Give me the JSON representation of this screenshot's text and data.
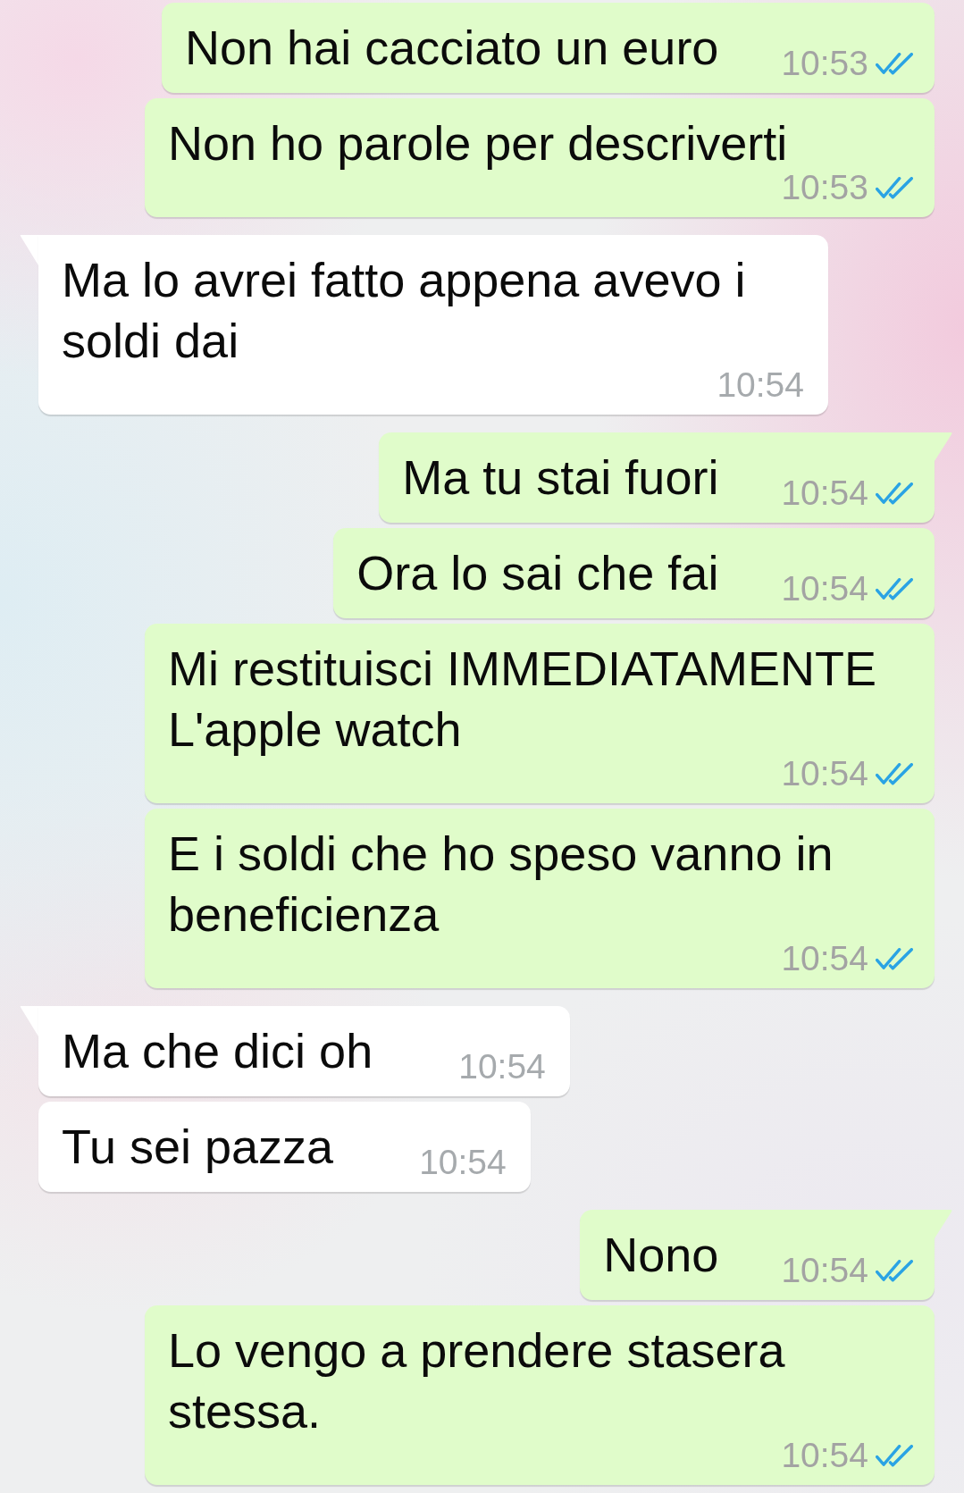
{
  "messages": [
    {
      "kind": "sent",
      "text": "Non hai cacciato un euro",
      "time": "10:53",
      "read": true,
      "tail": false
    },
    {
      "kind": "sent",
      "text": "Non ho parole per descriverti",
      "time": "10:53",
      "read": true,
      "tail": false
    },
    {
      "kind": "received",
      "text": "Ma lo avrei fatto appena avevo i soldi dai",
      "time": "10:54",
      "tail": true
    },
    {
      "kind": "sent",
      "text": "Ma tu stai fuori",
      "time": "10:54",
      "read": true,
      "tail": true
    },
    {
      "kind": "sent",
      "text": "Ora lo sai che fai",
      "time": "10:54",
      "read": true,
      "tail": false
    },
    {
      "kind": "sent",
      "text": "Mi restituisci IMMEDIATAMENTE L'apple watch",
      "time": "10:54",
      "read": true,
      "tail": false
    },
    {
      "kind": "sent",
      "text": "E i soldi che ho speso vanno in beneficienza",
      "time": "10:54",
      "read": true,
      "tail": false
    },
    {
      "kind": "received",
      "text": "Ma che dici oh",
      "time": "10:54",
      "tail": true
    },
    {
      "kind": "received",
      "text": "Tu sei pazza",
      "time": "10:54",
      "tail": false
    },
    {
      "kind": "sent",
      "text": "Nono",
      "time": "10:54",
      "read": true,
      "tail": true
    },
    {
      "kind": "sent",
      "text": "Lo vengo a prendere stasera stessa.",
      "time": "10:54",
      "read": true,
      "tail": false
    }
  ]
}
